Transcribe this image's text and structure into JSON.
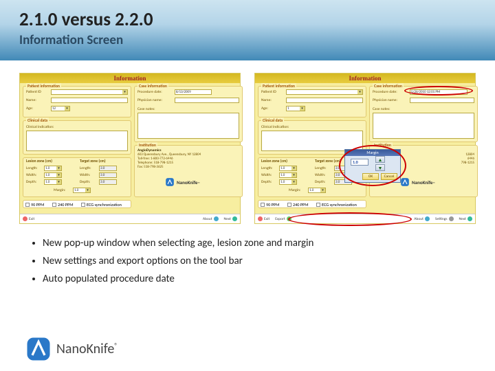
{
  "header": {
    "title": "2.1.0 versus 2.2.0",
    "subtitle": "Information Screen"
  },
  "shot_common": {
    "titlebar": "Information",
    "groups": {
      "patient": "Patient information",
      "case": "Case information",
      "clinical": "Clinical data",
      "institution": "Institution"
    },
    "labels": {
      "patient_id": "Patient ID",
      "name": "Name:",
      "age": "Age:",
      "procedure_date": "Procedure date:",
      "physician": "Physician name:",
      "case_notes": "Case notes:",
      "clinical_indication": "Clinical indication:",
      "lesion_zone": "Lesion zone (cm)",
      "target_zone": "Target zone (cm)",
      "length": "Length:",
      "width": "Width:",
      "depth": "Depth:",
      "margin": "Margin:"
    },
    "footer": {
      "ppm90": "90 PPM",
      "ppm240": "240 PPM",
      "ecg": "ECG synchronization",
      "exit": "Exit",
      "about": "About",
      "next": "Next",
      "export": "Export",
      "settings": "Settings"
    },
    "institution_left": {
      "l1": "AngioDynamics",
      "l2": "603 Queensbury Ave., Queensbury, NY 12804",
      "l3": "Toll-free: 1-800-772-6446",
      "l4": "Telephone: 518-798-1215",
      "l5": "Fax: 518-798-3625"
    },
    "institution_right": {
      "l1": "…",
      "l2": "12804",
      "l3": "6446",
      "l4": "798-1215"
    },
    "brand": "NanoKnife",
    "tm": "™"
  },
  "left": {
    "age": "12",
    "proc_date": "8/13/2009",
    "lesion": {
      "length": "1.0",
      "width": "1.0",
      "depth": "1.0"
    },
    "target": {
      "length": "3.0",
      "width": "3.0",
      "depth": "3.0"
    },
    "margin": "1.0"
  },
  "right": {
    "age": "1",
    "proc_date": "5/26/2010 12:01 PM",
    "lesion": {
      "length": "1.0",
      "width": "1.0",
      "depth": "1.0"
    },
    "target": {
      "length": "3.0",
      "width": "3.0",
      "depth": "3.0"
    },
    "margin": "1.0",
    "popup": {
      "title": "Margin",
      "value": "1.0",
      "ok": "OK",
      "cancel": "Cancel"
    }
  },
  "bullets": [
    "New pop-up window when selecting age, lesion zone and margin",
    "New settings and export options on the tool bar",
    "Auto populated procedure date"
  ],
  "bottombrand": {
    "name": "NanoKnife",
    "mark": "®"
  }
}
